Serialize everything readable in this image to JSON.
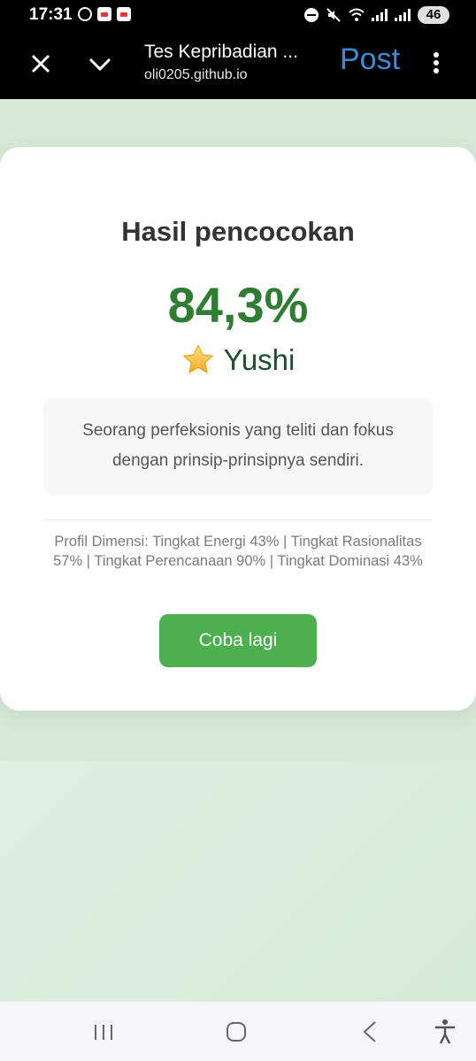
{
  "status_bar": {
    "time": "17:31",
    "battery": "46",
    "icons": [
      "whatsapp-icon",
      "calendar-icon",
      "calendar-icon",
      "dnd-icon",
      "mute-icon",
      "wifi-icon",
      "signal-icon",
      "signal-icon"
    ]
  },
  "browser": {
    "title": "Tes Kepribadian ...",
    "url": "oli0205.github.io",
    "post_label": "Post",
    "icons": [
      "close-icon",
      "chevron-down-icon",
      "more-vert-icon"
    ],
    "accent": "#3d8bd8"
  },
  "result": {
    "heading": "Hasil pencocokan",
    "percent": "84,3%",
    "type_name": "Yushi",
    "type_icon": "star-icon",
    "description": "Seorang perfeksionis yang teliti dan fokus dengan prinsip-prinsipnya sendiri.",
    "dimension_profile": "Profil Dimensi: Tingkat Energi 43% | Tingkat Rasionalitas 57% | Tingkat Perencanaan 90% | Tingkat Dominasi 43%",
    "retry_label": "Coba lagi",
    "colors": {
      "percent": "#2e7d32",
      "button": "#4caf50"
    }
  },
  "nav_bar": {
    "icons": [
      "recents-icon",
      "home-icon",
      "back-icon",
      "accessibility-icon"
    ]
  }
}
